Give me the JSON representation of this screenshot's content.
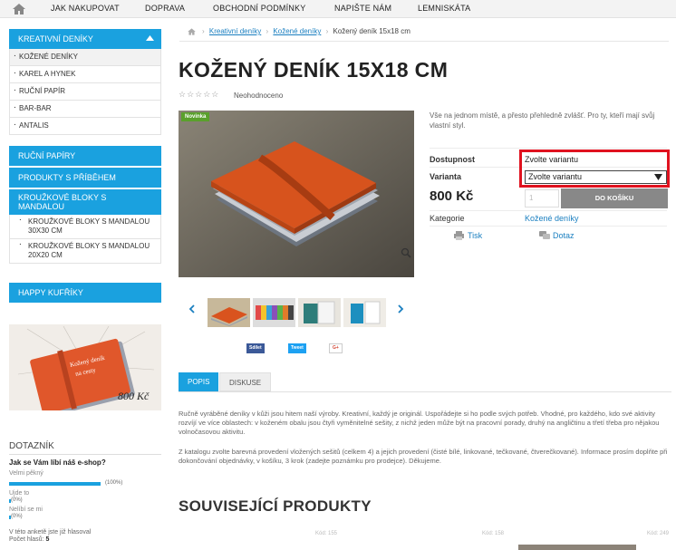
{
  "nav": {
    "items": [
      "JAK NAKUPOVAT",
      "DOPRAVA",
      "OBCHODNÍ PODMÍNKY",
      "NAPIŠTE NÁM",
      "LEMNISKÁTA"
    ]
  },
  "sidebar": {
    "cat1": {
      "label": "KREATIVNÍ DENÍKY",
      "subs": [
        "KOŽENÉ DENÍKY",
        "KAREL A HYNEK",
        "RUČNÍ PAPÍR",
        "BAR-BAR",
        "ANTALIS"
      ]
    },
    "cat2": "RUČNÍ PAPÍRY",
    "cat3": "PRODUKTY S PŘÍBĚHEM",
    "cat4": {
      "label": "KROUŽKOVÉ BLOKY S MANDALOU",
      "subs": [
        "KROUŽKOVÉ BLOKY S MANDALOU 30X30 CM",
        "KROUŽKOVÉ BLOKY S MANDALOU 20X20 CM"
      ]
    },
    "cat5": "HAPPY KUFŘÍKY",
    "promo": {
      "text_line1": "Kožený deník",
      "text_line2": "na cesty",
      "price": "800 Kč"
    }
  },
  "poll": {
    "title": "DOTAZNÍK",
    "question": "Jak se Vám líbí náš e-shop?",
    "options": [
      {
        "label": "Velmi pěkný",
        "pct": "(100%)",
        "fraction": 1.0
      },
      {
        "label": "Ujde to",
        "pct": "(0%)",
        "fraction": 0
      },
      {
        "label": "Nelíbí se mi",
        "pct": "(0%)",
        "fraction": 0
      }
    ],
    "footer_line1": "V této anketě jste již hlasoval",
    "footer_label": "Počet hlasů:",
    "footer_count": "5"
  },
  "breadcrumb": {
    "items": [
      "Kreativní deníky",
      "Kožené deníky"
    ],
    "current": "Kožený deník 15x18 cm",
    "sep": "›"
  },
  "product": {
    "title": "KOŽENÝ DENÍK 15X18 CM",
    "stars": "☆☆☆☆☆",
    "rating_text": "Neohodnoceno",
    "badge": "Novinka",
    "short_desc": "Vše na jednom místě, a přesto přehledně zvlášť. Pro ty, kteří mají svůj vlastní styl.",
    "availability_label": "Dostupnost",
    "availability_value": "Zvolte variantu",
    "variant_label": "Varianta",
    "variant_selected": "Zvolte variantu",
    "price": "800 Kč",
    "qty": "1",
    "add_to_cart": "DO KOŠÍKU",
    "category_label": "Kategorie",
    "category_value": "Kožené deníky",
    "print": "Tisk",
    "ask": "Dotaz"
  },
  "share": {
    "facebook": "Sdílet",
    "twitter": "Tweet",
    "gplus": "G+"
  },
  "tabs": {
    "popis": "POPIS",
    "diskuse": "DISKUSE"
  },
  "description": {
    "p1": "Ručně vyráběné deníky v kůži jsou hitem naší výroby. Kreativní, každý je originál. Uspořádejte si ho podle svých potřeb. Vhodné, pro každého, kdo své aktivity rozvíjí ve více oblastech: v koženém obalu jsou čtyři vyměnitelné sešity, z nichž jeden může být na pracovní porady, druhý na angličtinu a třetí třeba pro nějakou volnočasovou aktivitu.",
    "p2": "Z katalogu zvolte barevná provedení vložených sešitů (celkem 4) a jejich provedení (čisté bílé, linkované, tečkované, čtverečkované). Informace prosím doplňte při dokončování objednávky, v košíku, 3 krok (zadejte poznámku pro prodejce). Děkujeme."
  },
  "related": {
    "title": "SOUVISEJÍCÍ PRODUKTY",
    "codes": [
      "Kód: 155",
      "Kód: 158",
      "Kód: 249"
    ]
  }
}
